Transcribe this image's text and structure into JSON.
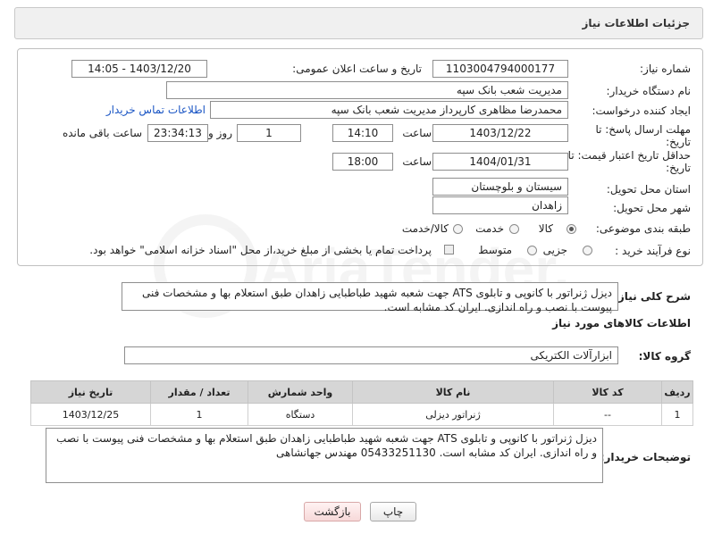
{
  "page_title": "جزئیات اطلاعات نیاز",
  "need_number": {
    "label": "شماره نیاز:",
    "value": "1103004794000177"
  },
  "announce": {
    "label": "تاریخ و ساعت اعلان عمومی:",
    "value": "1403/12/20 - 14:05"
  },
  "buyer_org": {
    "label": "نام دستگاه خریدار:",
    "value": "مدیریت شعب بانک سپه"
  },
  "requester": {
    "label": "ایجاد کننده درخواست:",
    "value": "محمدرضا مظاهری کارپرداز مدیریت شعب بانک سپه",
    "contact_link": "اطلاعات تماس خریدار"
  },
  "deadline": {
    "label_line1": "مهلت ارسال پاسخ: تا",
    "label_line2": "تاریخ:",
    "date": "1403/12/22",
    "time_label": "ساعت",
    "time": "14:10",
    "days": "1",
    "days_label": "روز و",
    "remaining": "23:34:13",
    "remaining_label": "ساعت باقی مانده"
  },
  "price_validity": {
    "label_line1": "حداقل تاریخ اعتبار قیمت: تا",
    "label_line2": "تاریخ:",
    "date": "1404/01/31",
    "time_label": "ساعت",
    "time": "18:00"
  },
  "province": {
    "label": "استان محل تحویل:",
    "value": "سیستان و بلوچستان"
  },
  "city": {
    "label": "شهر محل تحویل:",
    "value": "زاهدان"
  },
  "category": {
    "label": "طبقه بندی موضوعی:",
    "options": [
      "کالا",
      "خدمت",
      "کالا/خدمت"
    ],
    "selected": "کالا"
  },
  "purchase_type": {
    "label": "نوع فرآیند خرید :",
    "options": [
      "جزیی",
      "متوسط"
    ],
    "payment_note": "پرداخت تمام یا بخشی از مبلغ خرید،از محل \"اسناد خزانه اسلامی\" خواهد بود."
  },
  "description": {
    "label": "شرح کلی نیاز:",
    "value": "دیزل ژنراتور با کانوپی و تابلوی ATS جهت شعبه شهید طباطبایی  زاهدان طبق استعلام بها و مشخصات فنی پیوست با نصب و راه اندازی. ایران کد مشابه است."
  },
  "goods_section_title": "اطلاعات کالاهای مورد نیاز",
  "goods_group": {
    "label": "گروه کالا:",
    "value": "ابزارآلات الکتریکی"
  },
  "table": {
    "headers": [
      "ردیف",
      "کد کالا",
      "نام کالا",
      "واحد شمارش",
      "تعداد / مقدار",
      "تاریخ نیاز"
    ],
    "rows": [
      [
        "1",
        "--",
        "ژنراتور دیزلی",
        "دستگاه",
        "1",
        "1403/12/25"
      ]
    ]
  },
  "buyer_notes": {
    "label": "توضیحات خریدار:",
    "value": "دیزل ژنراتور با کانوپی و تابلوی ATS جهت شعبه شهید طباطبایی  زاهدان طبق استعلام بها و مشخصات فنی پیوست با نصب و راه اندازی. ایران کد مشابه است. 05433251130 مهندس جهانشاهی"
  },
  "buttons": {
    "print": "چاپ",
    "back": "بازگشت"
  },
  "watermark_text": "AriaTender.neT"
}
